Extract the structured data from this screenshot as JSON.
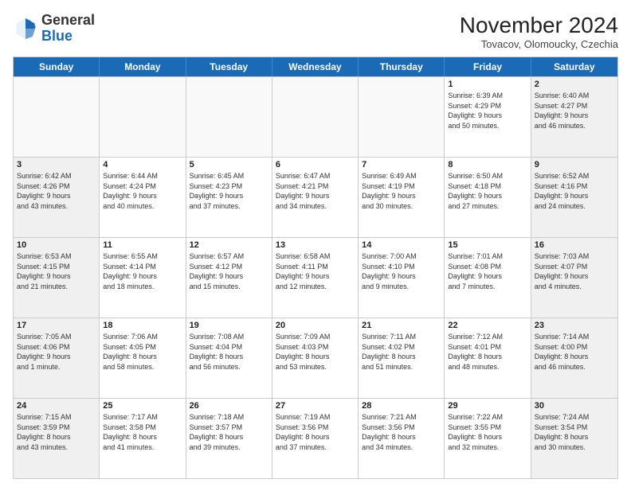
{
  "logo": {
    "general": "General",
    "blue": "Blue"
  },
  "header": {
    "month": "November 2024",
    "location": "Tovacov, Olomoucky, Czechia"
  },
  "days": [
    "Sunday",
    "Monday",
    "Tuesday",
    "Wednesday",
    "Thursday",
    "Friday",
    "Saturday"
  ],
  "weeks": [
    [
      {
        "day": "",
        "info": ""
      },
      {
        "day": "",
        "info": ""
      },
      {
        "day": "",
        "info": ""
      },
      {
        "day": "",
        "info": ""
      },
      {
        "day": "",
        "info": ""
      },
      {
        "day": "1",
        "info": "Sunrise: 6:39 AM\nSunset: 4:29 PM\nDaylight: 9 hours\nand 50 minutes."
      },
      {
        "day": "2",
        "info": "Sunrise: 6:40 AM\nSunset: 4:27 PM\nDaylight: 9 hours\nand 46 minutes."
      }
    ],
    [
      {
        "day": "3",
        "info": "Sunrise: 6:42 AM\nSunset: 4:26 PM\nDaylight: 9 hours\nand 43 minutes."
      },
      {
        "day": "4",
        "info": "Sunrise: 6:44 AM\nSunset: 4:24 PM\nDaylight: 9 hours\nand 40 minutes."
      },
      {
        "day": "5",
        "info": "Sunrise: 6:45 AM\nSunset: 4:23 PM\nDaylight: 9 hours\nand 37 minutes."
      },
      {
        "day": "6",
        "info": "Sunrise: 6:47 AM\nSunset: 4:21 PM\nDaylight: 9 hours\nand 34 minutes."
      },
      {
        "day": "7",
        "info": "Sunrise: 6:49 AM\nSunset: 4:19 PM\nDaylight: 9 hours\nand 30 minutes."
      },
      {
        "day": "8",
        "info": "Sunrise: 6:50 AM\nSunset: 4:18 PM\nDaylight: 9 hours\nand 27 minutes."
      },
      {
        "day": "9",
        "info": "Sunrise: 6:52 AM\nSunset: 4:16 PM\nDaylight: 9 hours\nand 24 minutes."
      }
    ],
    [
      {
        "day": "10",
        "info": "Sunrise: 6:53 AM\nSunset: 4:15 PM\nDaylight: 9 hours\nand 21 minutes."
      },
      {
        "day": "11",
        "info": "Sunrise: 6:55 AM\nSunset: 4:14 PM\nDaylight: 9 hours\nand 18 minutes."
      },
      {
        "day": "12",
        "info": "Sunrise: 6:57 AM\nSunset: 4:12 PM\nDaylight: 9 hours\nand 15 minutes."
      },
      {
        "day": "13",
        "info": "Sunrise: 6:58 AM\nSunset: 4:11 PM\nDaylight: 9 hours\nand 12 minutes."
      },
      {
        "day": "14",
        "info": "Sunrise: 7:00 AM\nSunset: 4:10 PM\nDaylight: 9 hours\nand 9 minutes."
      },
      {
        "day": "15",
        "info": "Sunrise: 7:01 AM\nSunset: 4:08 PM\nDaylight: 9 hours\nand 7 minutes."
      },
      {
        "day": "16",
        "info": "Sunrise: 7:03 AM\nSunset: 4:07 PM\nDaylight: 9 hours\nand 4 minutes."
      }
    ],
    [
      {
        "day": "17",
        "info": "Sunrise: 7:05 AM\nSunset: 4:06 PM\nDaylight: 9 hours\nand 1 minute."
      },
      {
        "day": "18",
        "info": "Sunrise: 7:06 AM\nSunset: 4:05 PM\nDaylight: 8 hours\nand 58 minutes."
      },
      {
        "day": "19",
        "info": "Sunrise: 7:08 AM\nSunset: 4:04 PM\nDaylight: 8 hours\nand 56 minutes."
      },
      {
        "day": "20",
        "info": "Sunrise: 7:09 AM\nSunset: 4:03 PM\nDaylight: 8 hours\nand 53 minutes."
      },
      {
        "day": "21",
        "info": "Sunrise: 7:11 AM\nSunset: 4:02 PM\nDaylight: 8 hours\nand 51 minutes."
      },
      {
        "day": "22",
        "info": "Sunrise: 7:12 AM\nSunset: 4:01 PM\nDaylight: 8 hours\nand 48 minutes."
      },
      {
        "day": "23",
        "info": "Sunrise: 7:14 AM\nSunset: 4:00 PM\nDaylight: 8 hours\nand 46 minutes."
      }
    ],
    [
      {
        "day": "24",
        "info": "Sunrise: 7:15 AM\nSunset: 3:59 PM\nDaylight: 8 hours\nand 43 minutes."
      },
      {
        "day": "25",
        "info": "Sunrise: 7:17 AM\nSunset: 3:58 PM\nDaylight: 8 hours\nand 41 minutes."
      },
      {
        "day": "26",
        "info": "Sunrise: 7:18 AM\nSunset: 3:57 PM\nDaylight: 8 hours\nand 39 minutes."
      },
      {
        "day": "27",
        "info": "Sunrise: 7:19 AM\nSunset: 3:56 PM\nDaylight: 8 hours\nand 37 minutes."
      },
      {
        "day": "28",
        "info": "Sunrise: 7:21 AM\nSunset: 3:56 PM\nDaylight: 8 hours\nand 34 minutes."
      },
      {
        "day": "29",
        "info": "Sunrise: 7:22 AM\nSunset: 3:55 PM\nDaylight: 8 hours\nand 32 minutes."
      },
      {
        "day": "30",
        "info": "Sunrise: 7:24 AM\nSunset: 3:54 PM\nDaylight: 8 hours\nand 30 minutes."
      }
    ]
  ]
}
